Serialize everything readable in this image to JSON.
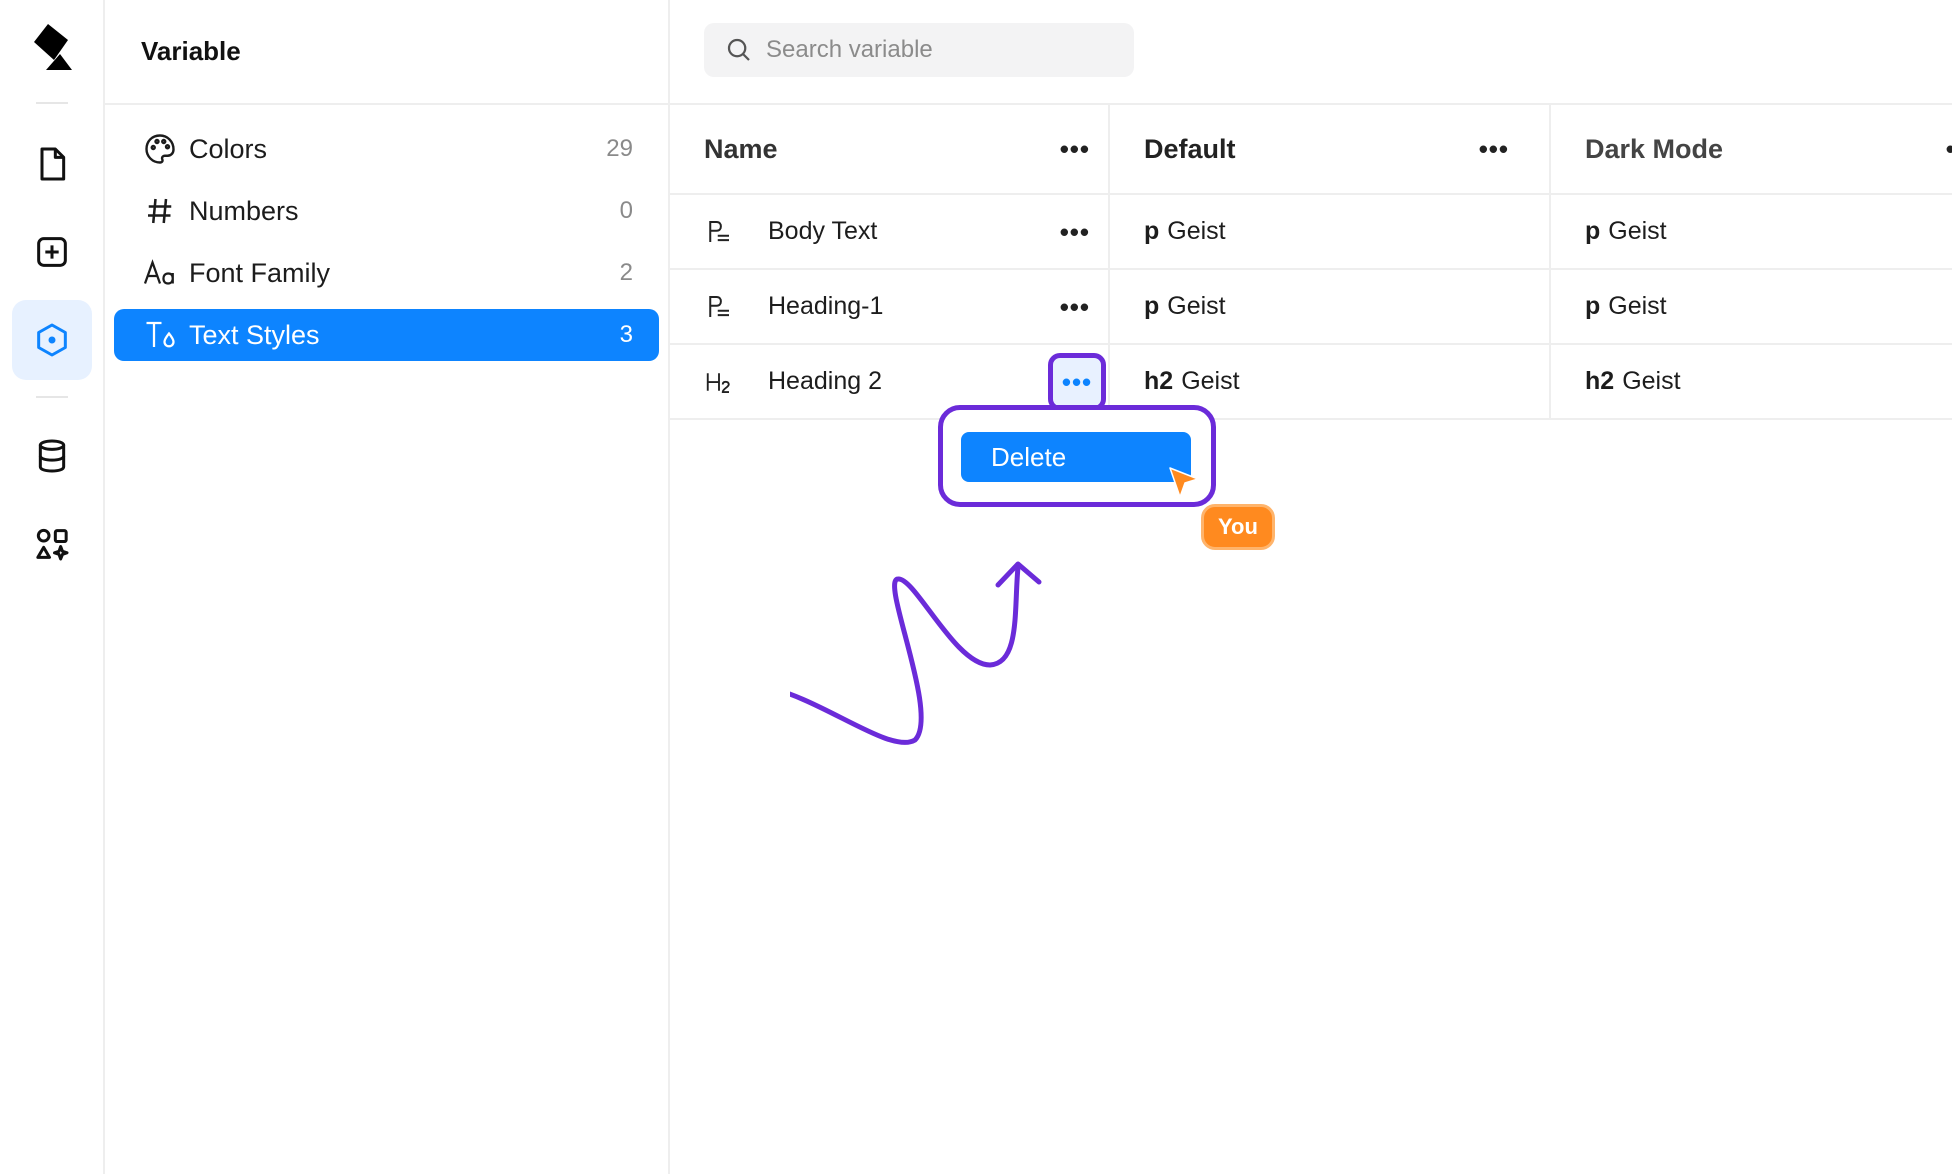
{
  "rail": {
    "icons": [
      "logo-icon",
      "file-icon",
      "add-square-icon",
      "variables-hexagon-icon",
      "database-icon",
      "components-icon"
    ],
    "accent": "#0d84ff"
  },
  "panel": {
    "title": "Variable",
    "items": [
      {
        "label": "Colors",
        "count": "29",
        "icon": "palette-icon"
      },
      {
        "label": "Numbers",
        "count": "0",
        "icon": "hash-icon"
      },
      {
        "label": "Font Family",
        "count": "2",
        "icon": "font-aa-icon"
      },
      {
        "label": "Text Styles",
        "count": "3",
        "icon": "text-style-icon"
      }
    ]
  },
  "search": {
    "placeholder": "Search variable"
  },
  "table": {
    "columns": [
      "Name",
      "Default",
      "Dark Mode"
    ],
    "rows": [
      {
        "name": "Body Text",
        "icon": "paragraph-icon",
        "default_tag": "p",
        "default_font": "Geist",
        "dark_tag": "p",
        "dark_font": "Geist"
      },
      {
        "name": "Heading-1",
        "icon": "paragraph-icon",
        "default_tag": "p",
        "default_font": "Geist",
        "dark_tag": "p",
        "dark_font": "Geist"
      },
      {
        "name": "Heading 2",
        "icon": "h2-icon",
        "default_tag": "h2",
        "default_font": "Geist",
        "dark_tag": "h2",
        "dark_font": "Geist"
      }
    ]
  },
  "context_menu": {
    "delete_label": "Delete"
  },
  "cursor": {
    "label": "You",
    "color": "#ff8a1f"
  },
  "annotation_color": "#6b2bd9"
}
